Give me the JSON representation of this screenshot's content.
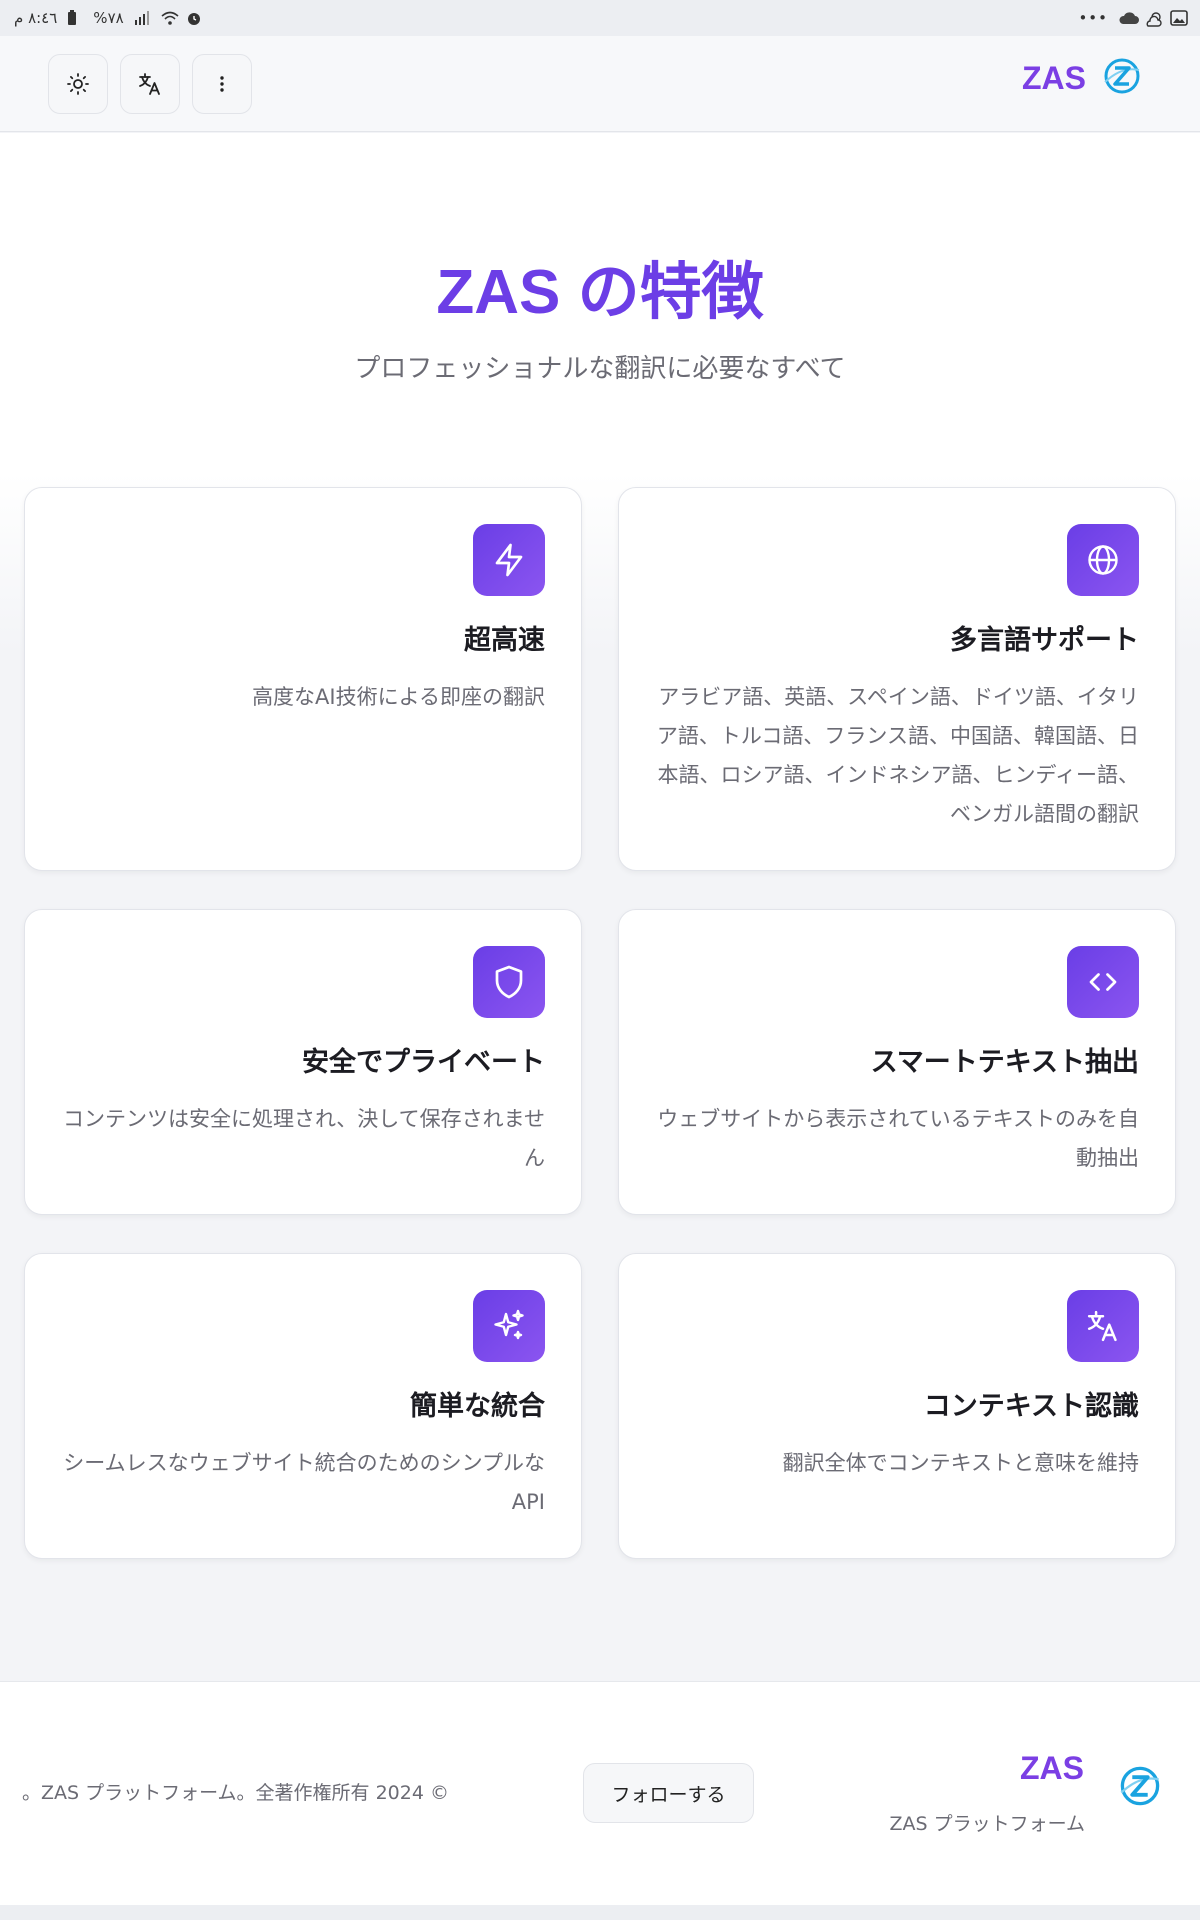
{
  "status_bar": {
    "time": "٨:٤٦ م",
    "battery": "%٧٨",
    "more": "•••"
  },
  "header": {
    "brand": "ZAS",
    "theme_button_icon": "sun-icon",
    "translate_button_icon": "translate-icon",
    "menu_button_icon": "more-vertical-icon"
  },
  "hero": {
    "title": "ZAS の特徴",
    "subtitle": "プロフェッショナルな翻訳に必要なすべて"
  },
  "features": [
    {
      "icon": "lightning-icon",
      "title": "超高速",
      "description": "高度なAI技術による即座の翻訳"
    },
    {
      "icon": "globe-icon",
      "title": "多言語サポート",
      "description": "アラビア語、英語、スペイン語、ドイツ語、イタリア語、トルコ語、フランス語、中国語、韓国語、日本語、ロシア語、インドネシア語、ヒンディー語、ベンガル語間の翻訳"
    },
    {
      "icon": "shield-icon",
      "title": "安全でプライベート",
      "description": "コンテンツは安全に処理され、決して保存されません"
    },
    {
      "icon": "code-icon",
      "title": "スマートテキスト抽出",
      "description": "ウェブサイトから表示されているテキストのみを自動抽出"
    },
    {
      "icon": "sparkles-icon",
      "title": "簡単な統合",
      "description": "シームレスなウェブサイト統合のためのシンプルなAPI"
    },
    {
      "icon": "translate-icon",
      "title": "コンテキスト認識",
      "description": "翻訳全体でコンテキストと意味を維持"
    }
  ],
  "footer": {
    "copyright": "。ZAS プラットフォーム。全著作権所有 2024 ©",
    "follow_label": "フォローする",
    "brand": "ZAS",
    "brand_subtitle": "ZAS プラットフォーム"
  },
  "colors": {
    "accent": "#6c3ee6",
    "logo_blue": "#1aa3e0"
  }
}
